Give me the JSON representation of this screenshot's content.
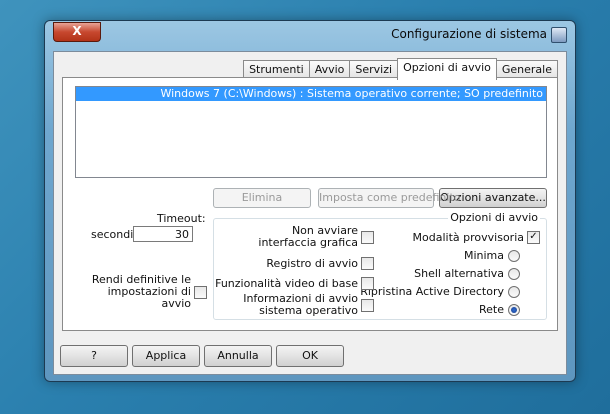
{
  "window": {
    "title": "Configurazione di sistema",
    "close_label": "X"
  },
  "tabs": [
    {
      "label": "Generale",
      "active": false
    },
    {
      "label": "Opzioni di avvio",
      "active": true
    },
    {
      "label": "Servizi",
      "active": false
    },
    {
      "label": "Avvio",
      "active": false
    },
    {
      "label": "Strumenti",
      "active": false
    }
  ],
  "os_list": {
    "items": [
      "Windows 7 (C:\\Windows) : Sistema operativo corrente; SO predefinito"
    ]
  },
  "buttons": {
    "advanced": "Opzioni avanzate...",
    "set_default": "Imposta come predefinito",
    "delete": "Elimina",
    "ok": "OK",
    "cancel": "Annulla",
    "apply": "Applica",
    "help": "?"
  },
  "boot_options": {
    "legend": "Opzioni di avvio",
    "safe_boot_label": "Modalità provvisoria",
    "safe_boot_checked": true,
    "minimal": "Minima",
    "alternate_shell": "Shell alternativa",
    "ad_repair": "Ripristina Active Directory",
    "network": "Rete",
    "selected": "Rete"
  },
  "extra_options": {
    "no_gui": "Non avviare interfaccia grafica",
    "boot_log": "Registro di avvio",
    "base_video": "Funzionalità video di base",
    "os_info": "Informazioni di avvio sistema operativo"
  },
  "timeout": {
    "label": "Timeout:",
    "value": "30",
    "unit": "secondi"
  },
  "permanent": {
    "label": "Rendi definitive le impostazioni di avvio"
  }
}
